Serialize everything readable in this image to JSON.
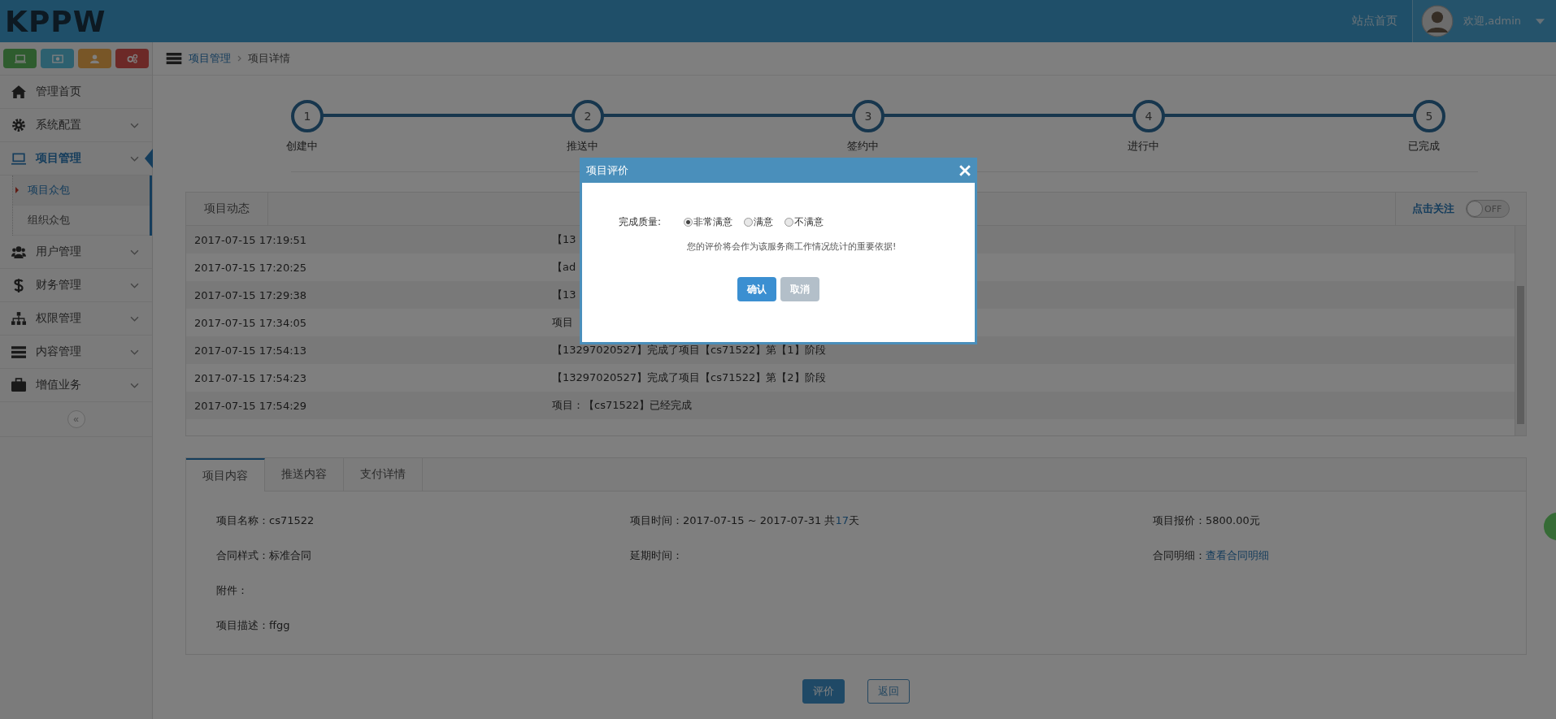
{
  "header": {
    "logo": "KPPW",
    "site_home": "站点首页",
    "user": "欢迎,admin"
  },
  "sidebar": {
    "quick_buttons": [
      {
        "kind": "monitor"
      },
      {
        "kind": "money"
      },
      {
        "kind": "user"
      },
      {
        "kind": "gears"
      }
    ],
    "items": [
      {
        "kind": "home",
        "label": "管理首页",
        "selected": false,
        "expandable": false
      },
      {
        "kind": "gear",
        "label": "系统配置",
        "selected": false,
        "expandable": true
      },
      {
        "kind": "monitor",
        "label": "项目管理",
        "selected": true,
        "expandable": true,
        "children": [
          {
            "label": "项目众包",
            "selected": true
          },
          {
            "label": "组织众包",
            "selected": false
          }
        ]
      },
      {
        "kind": "users",
        "label": "用户管理",
        "selected": false,
        "expandable": true
      },
      {
        "kind": "dollar",
        "label": "财务管理",
        "selected": false,
        "expandable": true
      },
      {
        "kind": "sitemap",
        "label": "权限管理",
        "selected": false,
        "expandable": true
      },
      {
        "kind": "list",
        "label": "内容管理",
        "selected": false,
        "expandable": true
      },
      {
        "kind": "briefcase",
        "label": "增值业务",
        "selected": false,
        "expandable": true
      }
    ],
    "collapse": "«"
  },
  "breadcrumb": [
    "项目管理",
    "项目详情"
  ],
  "steps": [
    {
      "number": "1",
      "label": "创建中"
    },
    {
      "number": "2",
      "label": "推送中"
    },
    {
      "number": "3",
      "label": "签约中"
    },
    {
      "number": "4",
      "label": "进行中"
    },
    {
      "number": "5",
      "label": "已完成"
    }
  ],
  "activity": {
    "tab": "项目动态",
    "follow": "点击关注",
    "toggle": {
      "label": "OFF",
      "on": false
    },
    "rows": [
      {
        "time": "2017-07-15 17:19:51",
        "message": "【13"
      },
      {
        "time": "2017-07-15 17:20:25",
        "message": "【ad"
      },
      {
        "time": "2017-07-15 17:29:38",
        "message": "【13"
      },
      {
        "time": "2017-07-15 17:34:05",
        "message": "项目"
      },
      {
        "time": "2017-07-15 17:54:13",
        "message": "【13297020527】完成了项目【cs71522】第【1】阶段"
      },
      {
        "time": "2017-07-15 17:54:23",
        "message": "【13297020527】完成了项目【cs71522】第【2】阶段"
      },
      {
        "time": "2017-07-15 17:54:29",
        "message": "项目：【cs71522】已经完成"
      }
    ]
  },
  "details": {
    "tabs": [
      {
        "label": "项目内容",
        "selected": true
      },
      {
        "label": "推送内容",
        "selected": false
      },
      {
        "label": "支付详情",
        "selected": false
      }
    ],
    "fields": [
      {
        "label": "项目名称：",
        "value": "cs71522"
      },
      {
        "label": "项目时间：",
        "value": "2017-07-15 ~ 2017-07-31 共",
        "highlight": "17",
        "suffix": "天"
      },
      {
        "label": "项目报价：",
        "value": "5800.00元"
      },
      {
        "label": "合同样式：",
        "value": "标准合同"
      },
      {
        "label": "延期时间："
      },
      {
        "label": "合同明细：",
        "link": "查看合同明细"
      },
      {
        "label": "附件："
      },
      {
        "label": "项目描述：",
        "value": "ffgg"
      }
    ]
  },
  "actions": [
    {
      "label": "评价",
      "kind": "primary"
    },
    {
      "label": "返回",
      "kind": "outline"
    }
  ],
  "modal": {
    "title": "项目评价",
    "quality_label": "完成质量:",
    "options": [
      {
        "label": "非常满意",
        "selected": true
      },
      {
        "label": "满意",
        "selected": false
      },
      {
        "label": "不满意",
        "selected": false
      }
    ],
    "note": "您的评价将会作为该服务商工作情况统计的重要依据!",
    "confirm": "确认",
    "cancel": "取消"
  }
}
